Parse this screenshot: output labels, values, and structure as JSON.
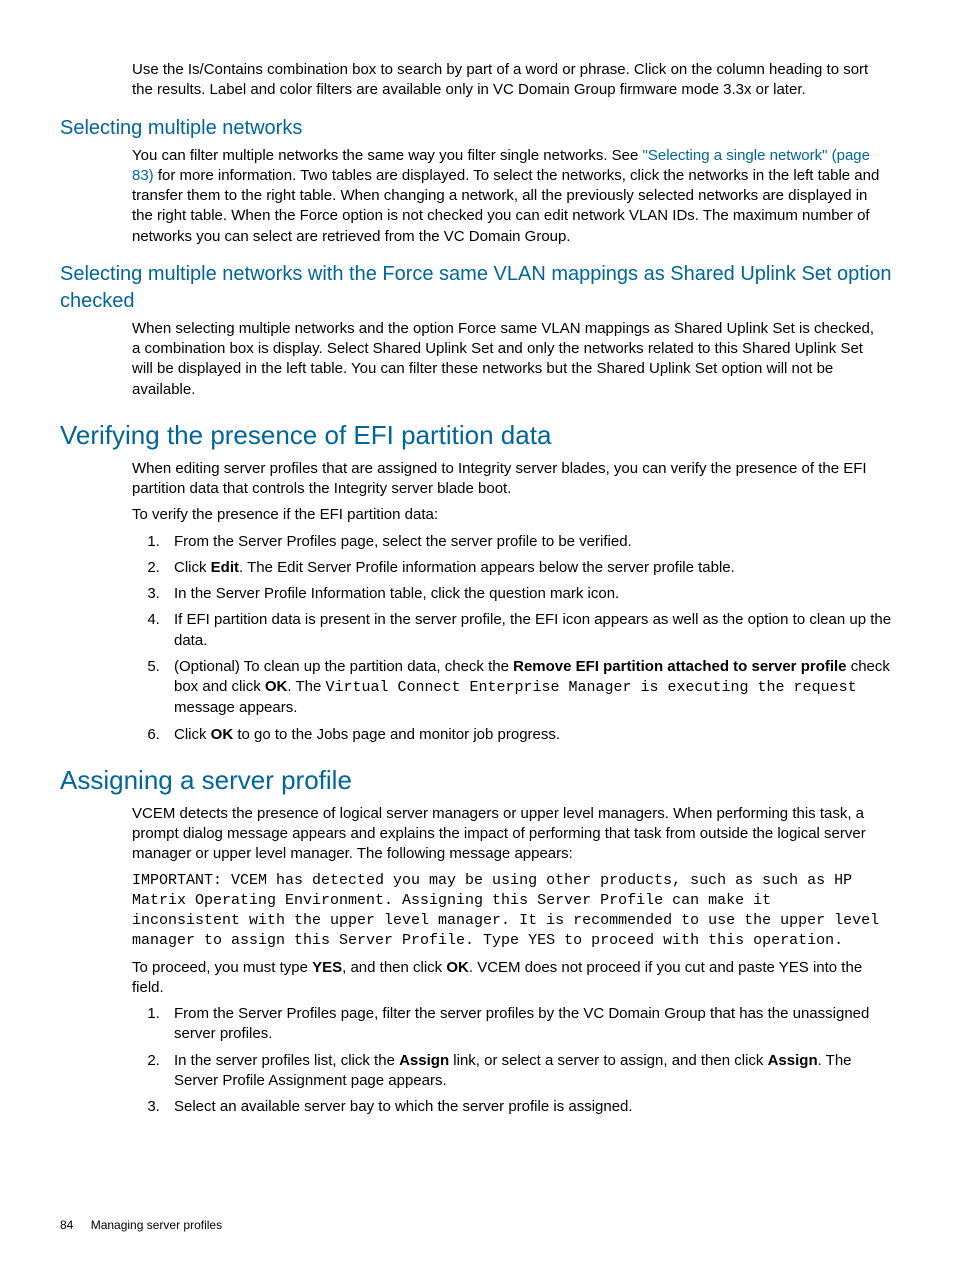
{
  "intro": {
    "p1": "Use the Is/Contains combination box to search by part of a word or phrase. Click on the column heading to sort the results.  Label and color filters are available only in VC Domain Group firmware mode 3.3x or later."
  },
  "sec1": {
    "title": "Selecting multiple networks",
    "p_pre": "You can filter multiple networks the same way you filter single networks. See ",
    "link": "\"Selecting a single network\" (page 83)",
    "p_post": " for more information. Two tables are displayed. To select the networks, click the networks in the left table and transfer them to the right table. When changing a network, all the previously selected networks are displayed in the right table. When the Force option is not checked you can edit network VLAN IDs. The maximum number of networks you can select are retrieved from the VC Domain Group."
  },
  "sec2": {
    "title": "Selecting multiple networks with the Force same VLAN mappings as Shared Uplink Set option checked",
    "p1": "When selecting multiple networks and the option Force same VLAN mappings as Shared Uplink Set is checked, a combination box is display. Select Shared Uplink Set and only the networks related to this Shared Uplink Set will be displayed in the left table. You can filter these networks but the Shared Uplink Set option will not be available."
  },
  "sec3": {
    "title": "Verifying the presence of EFI partition data",
    "p1": "When editing server profiles that are assigned to Integrity server blades, you can verify the presence of the EFI partition data that controls the Integrity server blade boot.",
    "p2": "To verify the presence if the EFI partition data:",
    "steps": {
      "s1": "From the Server Profiles page, select the server profile to be verified.",
      "s2a": "Click ",
      "s2b": "Edit",
      "s2c": ". The Edit Server Profile information appears below the server profile table.",
      "s3": "In the Server Profile Information table, click the question mark icon.",
      "s4": "If EFI partition data is present in the server profile, the EFI icon appears as well as the option to clean up the data.",
      "s5a": "(Optional) To clean up the partition data, check the ",
      "s5b": "Remove EFI partition attached to server profile",
      "s5c": " check box and click ",
      "s5d": "OK",
      "s5e": ". The ",
      "s5f": "Virtual Connect Enterprise Manager is executing the request",
      "s5g": " message appears.",
      "s6a": "Click ",
      "s6b": "OK",
      "s6c": " to go to the Jobs page and monitor job progress."
    }
  },
  "sec4": {
    "title": "Assigning a server profile",
    "p1": "VCEM detects the presence of logical server managers or upper level managers. When performing this task, a prompt dialog message appears and explains the impact of performing that task from outside the logical server manager or upper level manager. The following message appears:",
    "code": "IMPORTANT: VCEM has detected you may be using other products, such as such as HP Matrix Operating Environment. Assigning this Server Profile can make it inconsistent with the upper level manager. It is recommended to use the upper level manager to assign this Server Profile. Type YES to proceed with this operation.",
    "p2a": "To proceed, you must type ",
    "p2b": "YES",
    "p2c": ", and then click ",
    "p2d": "OK",
    "p2e": ". VCEM does not proceed if you cut and paste YES into the field.",
    "steps": {
      "s1": "From the Server Profiles page, filter the server profiles by the VC Domain Group that has the unassigned server profiles.",
      "s2a": "In the server profiles list, click the ",
      "s2b": "Assign",
      "s2c": " link, or select a server to assign, and then click ",
      "s2d": "Assign",
      "s2e": ". The Server Profile Assignment page appears.",
      "s3": "Select an available server bay to which the server profile is assigned."
    }
  },
  "footer": {
    "page": "84",
    "chapter": "Managing server profiles"
  }
}
